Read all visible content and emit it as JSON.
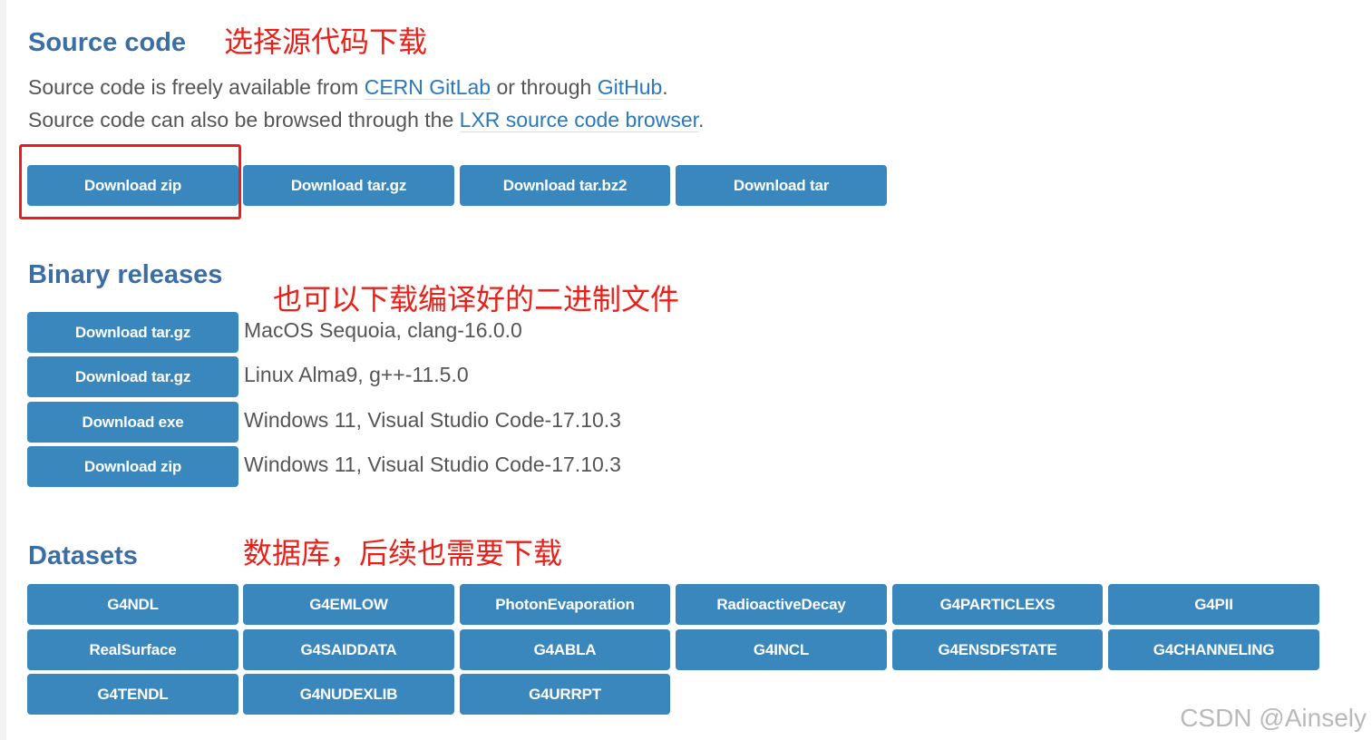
{
  "source": {
    "title": "Source code",
    "annotation": "选择源代码下载",
    "line1": {
      "text1": "Source code is freely available from ",
      "link1": "CERN GitLab",
      "text2": " or through ",
      "link2": "GitHub",
      "text3": "."
    },
    "line2": {
      "text1": "Source code can also be browsed through the ",
      "link1": "LXR source code browser",
      "text2": "."
    },
    "buttons": [
      "Download zip",
      "Download tar.gz",
      "Download tar.bz2",
      "Download tar"
    ]
  },
  "binary": {
    "title": "Binary releases",
    "annotation": "也可以下载编译好的二进制文件",
    "rows": [
      {
        "button": "Download tar.gz",
        "label": "MacOS Sequoia, clang-16.0.0"
      },
      {
        "button": "Download tar.gz",
        "label": "Linux Alma9, g++-11.5.0"
      },
      {
        "button": "Download exe",
        "label": "Windows 11, Visual Studio Code-17.10.3"
      },
      {
        "button": "Download zip",
        "label": "Windows 11, Visual Studio Code-17.10.3"
      }
    ]
  },
  "datasets": {
    "title": "Datasets",
    "annotation": "数据库，后续也需要下载",
    "items": [
      "G4NDL",
      "G4EMLOW",
      "PhotonEvaporation",
      "RadioactiveDecay",
      "G4PARTICLEXS",
      "G4PII",
      "RealSurface",
      "G4SAIDDATA",
      "G4ABLA",
      "G4INCL",
      "G4ENSDFSTATE",
      "G4CHANNELING",
      "G4TENDL",
      "G4NUDEXLIB",
      "G4URRPT"
    ]
  },
  "watermark": "CSDN @Ainsely",
  "colors": {
    "heading": "#3a6ea5",
    "button": "#3a87bd",
    "link": "#2b78b8",
    "annotation": "#e8201a"
  }
}
